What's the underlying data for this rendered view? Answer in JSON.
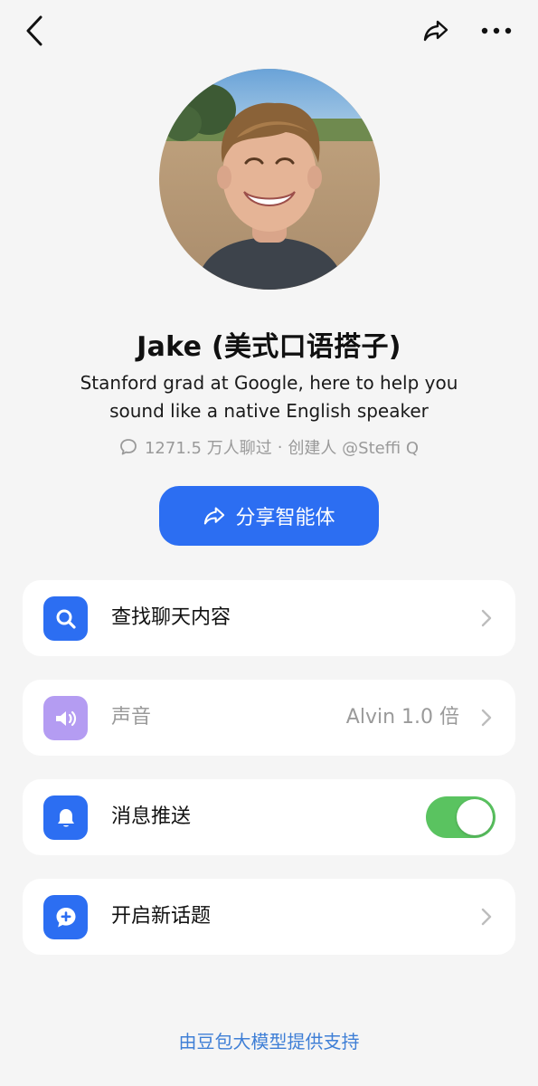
{
  "header": {
    "back_icon": "chevron-left-icon",
    "share_icon": "share-arrow-icon",
    "more_icon": "more-dots-icon"
  },
  "profile": {
    "name": "Jake (美式口语搭子)",
    "description": "Stanford grad at Google, here to help you sound like a native English speaker",
    "chat_count": "1271.5 万人聊过",
    "separator": "·",
    "creator": "创建人 @Steffi Q"
  },
  "share_button": {
    "label": "分享智能体"
  },
  "settings": [
    {
      "label": "查找聊天内容",
      "icon": "search-icon",
      "icon_color": "#2c6ef2"
    },
    {
      "label": "声音",
      "value": "Alvin 1.0 倍",
      "icon": "speaker-icon",
      "icon_color": "#b49cf2",
      "disabled": true
    },
    {
      "label": "消息推送",
      "icon": "bell-icon",
      "icon_color": "#2c6ef2",
      "toggle": true
    },
    {
      "label": "开启新话题",
      "icon": "new-topic-icon",
      "icon_color": "#2c6ef2"
    }
  ],
  "footer": {
    "text": "由豆包大模型提供支持"
  },
  "colors": {
    "accent": "#2c6ef2",
    "toggle_on": "#5ac360",
    "footer_link": "#3f7fd6"
  }
}
